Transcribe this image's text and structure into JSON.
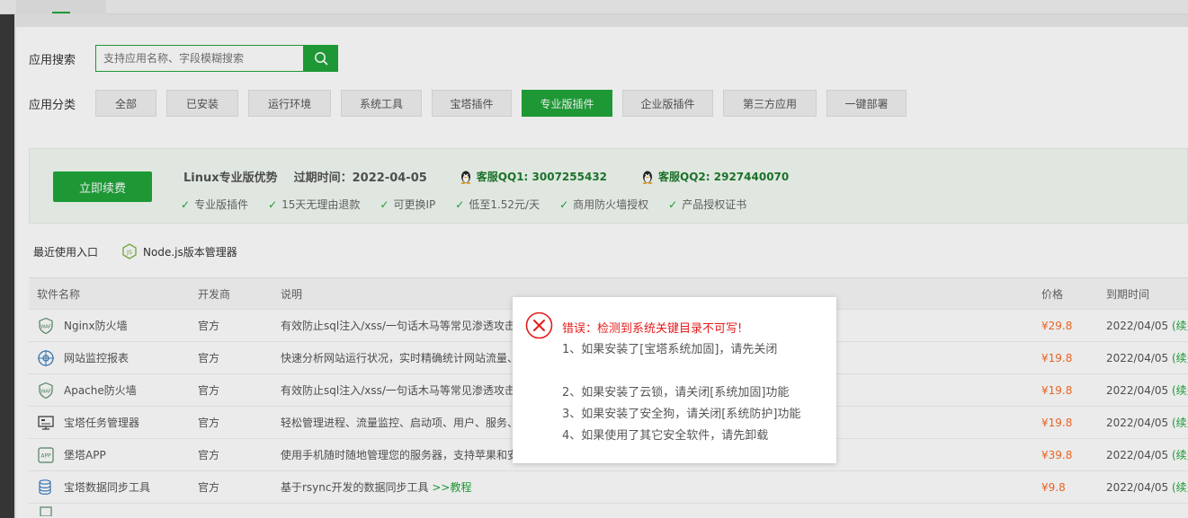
{
  "search": {
    "label": "应用搜索",
    "placeholder": "支持应用名称、字段模糊搜索"
  },
  "categories": {
    "label": "应用分类",
    "items": [
      "全部",
      "已安装",
      "运行环境",
      "系统工具",
      "宝塔插件",
      "专业版插件",
      "企业版插件",
      "第三方应用",
      "一键部署"
    ],
    "active": "专业版插件"
  },
  "promo": {
    "renew_label": "立即续费",
    "title": "Linux专业版优势",
    "expire": "过期时间：2022-04-05",
    "qq1": "客服QQ1: 3007255432",
    "qq2": "客服QQ2: 2927440070",
    "features": [
      "专业版插件",
      "15天无理由退款",
      "可更换IP",
      "低至1.52元/天",
      "商用防火墙授权",
      "产品授权证书"
    ]
  },
  "recent": {
    "label": "最近使用入口",
    "item": "Node.js版本管理器"
  },
  "table": {
    "headers": {
      "name": "软件名称",
      "dev": "开发商",
      "desc": "说明",
      "price": "价格",
      "expire": "到期时间"
    },
    "rows": [
      {
        "icon": "waf-icon",
        "name": "Nginx防火墙",
        "dev": "官方",
        "desc": "有效防止sql注入/xss/一句话木马等常见渗透攻击",
        "price": "¥29.8",
        "expire": "2022/04/05",
        "renew": "(续费"
      },
      {
        "icon": "monitor-icon",
        "name": "网站监控报表",
        "dev": "官方",
        "desc": "快速分析网站运行状况，实时精确统计网站流量、",
        "price": "¥19.8",
        "expire": "2022/04/05",
        "renew": "(续费"
      },
      {
        "icon": "waf-icon",
        "name": "Apache防火墙",
        "dev": "官方",
        "desc": "有效防止sql注入/xss/一句话木马等常见渗透攻击",
        "price": "¥19.8",
        "expire": "2022/04/05",
        "renew": "(续费"
      },
      {
        "icon": "task-manager-icon",
        "name": "宝塔任务管理器",
        "dev": "官方",
        "desc": "轻松管理进程、流量监控、启动项、用户、服务、",
        "price": "¥19.8",
        "expire": "2022/04/05",
        "renew": "(续费"
      },
      {
        "icon": "app-icon",
        "name": "堡塔APP",
        "dev": "官方",
        "desc": "使用手机随时随地管理您的服务器，支持苹果和安",
        "price": "¥39.8",
        "expire": "2022/04/05",
        "renew": "(续费"
      },
      {
        "icon": "database-sync-icon",
        "name": "宝塔数据同步工具",
        "dev": "官方",
        "desc": "基于rsync开发的数据同步工具",
        "desc_link": ">>教程",
        "price": "¥9.8",
        "expire": "2022/04/05",
        "renew": "(续费"
      }
    ]
  },
  "dialog": {
    "title": "错误：检测到系统关键目录不可写!",
    "lines": [
      "1、如果安装了[宝塔系统加固]，请先关闭",
      "",
      "2、如果安装了云锁，请关闭[系统加固]功能",
      "3、如果安装了安全狗，请关闭[系统防护]功能",
      "4、如果使用了其它安全软件，请先卸载"
    ]
  },
  "colors": {
    "accent": "#20a53a",
    "price": "#fc6d26",
    "error": "#e61c1c"
  }
}
